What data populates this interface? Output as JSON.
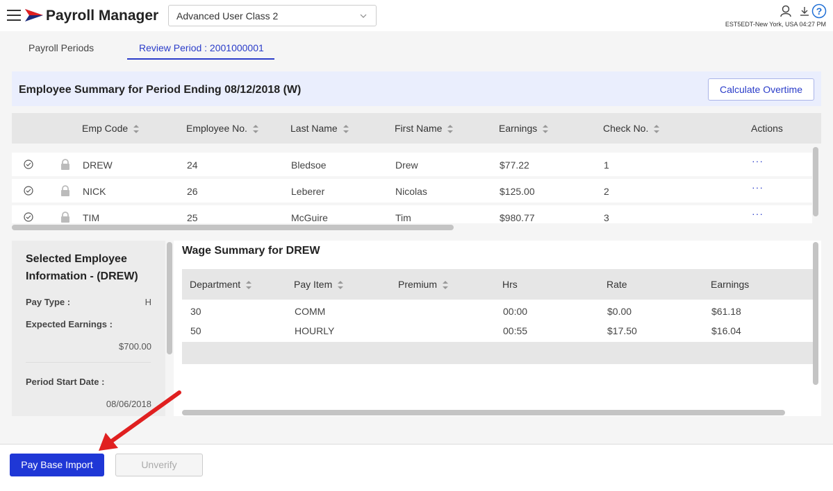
{
  "header": {
    "app_title": "Payroll Manager",
    "class_select": "Advanced User Class 2",
    "timezone": "EST5EDT-New York, USA 04:27 PM"
  },
  "tabs": [
    {
      "label": "Payroll Periods",
      "active": false
    },
    {
      "label": "Review Period : 2001000001",
      "active": true
    }
  ],
  "summary": {
    "title": "Employee Summary for Period Ending 08/12/2018 (W)",
    "calc_button": "Calculate Overtime"
  },
  "employee_table": {
    "columns": [
      "Emp Code",
      "Employee No.",
      "Last Name",
      "First Name",
      "Earnings",
      "Check No.",
      "Actions"
    ],
    "rows": [
      {
        "code": "DREW",
        "no": "24",
        "last": "Bledsoe",
        "first": "Drew",
        "earnings": "$77.22",
        "check": "1",
        "actions": "···"
      },
      {
        "code": "NICK",
        "no": "26",
        "last": "Leberer",
        "first": "Nicolas",
        "earnings": "$125.00",
        "check": "2",
        "actions": "···"
      },
      {
        "code": "TIM",
        "no": "25",
        "last": "McGuire",
        "first": "Tim",
        "earnings": "$980.77",
        "check": "3",
        "actions": "···"
      }
    ]
  },
  "selected_employee": {
    "title": "Selected Employee Information - (DREW)",
    "pay_type_label": "Pay Type",
    "pay_type_value": "H",
    "expected_earnings_label": "Expected Earnings",
    "expected_earnings_value": "$700.00",
    "period_start_label": "Period Start Date",
    "period_start_value": "08/06/2018"
  },
  "wage_summary": {
    "title": "Wage Summary for DREW",
    "columns": [
      "Department",
      "Pay Item",
      "Premium",
      "Hrs",
      "Rate",
      "Earnings"
    ],
    "rows": [
      {
        "dept": "30",
        "pay_item": "COMM",
        "premium": "",
        "hrs": "00:00",
        "rate": "$0.00",
        "earnings": "$61.18"
      },
      {
        "dept": "50",
        "pay_item": "HOURLY",
        "premium": "",
        "hrs": "00:55",
        "rate": "$17.50",
        "earnings": "$16.04"
      }
    ]
  },
  "footer": {
    "pay_base_import": "Pay Base Import",
    "unverify": "Unverify"
  },
  "colors": {
    "accent": "#2a3cc9",
    "primary_button": "#1f37d6",
    "annotation_arrow": "#e02020"
  }
}
